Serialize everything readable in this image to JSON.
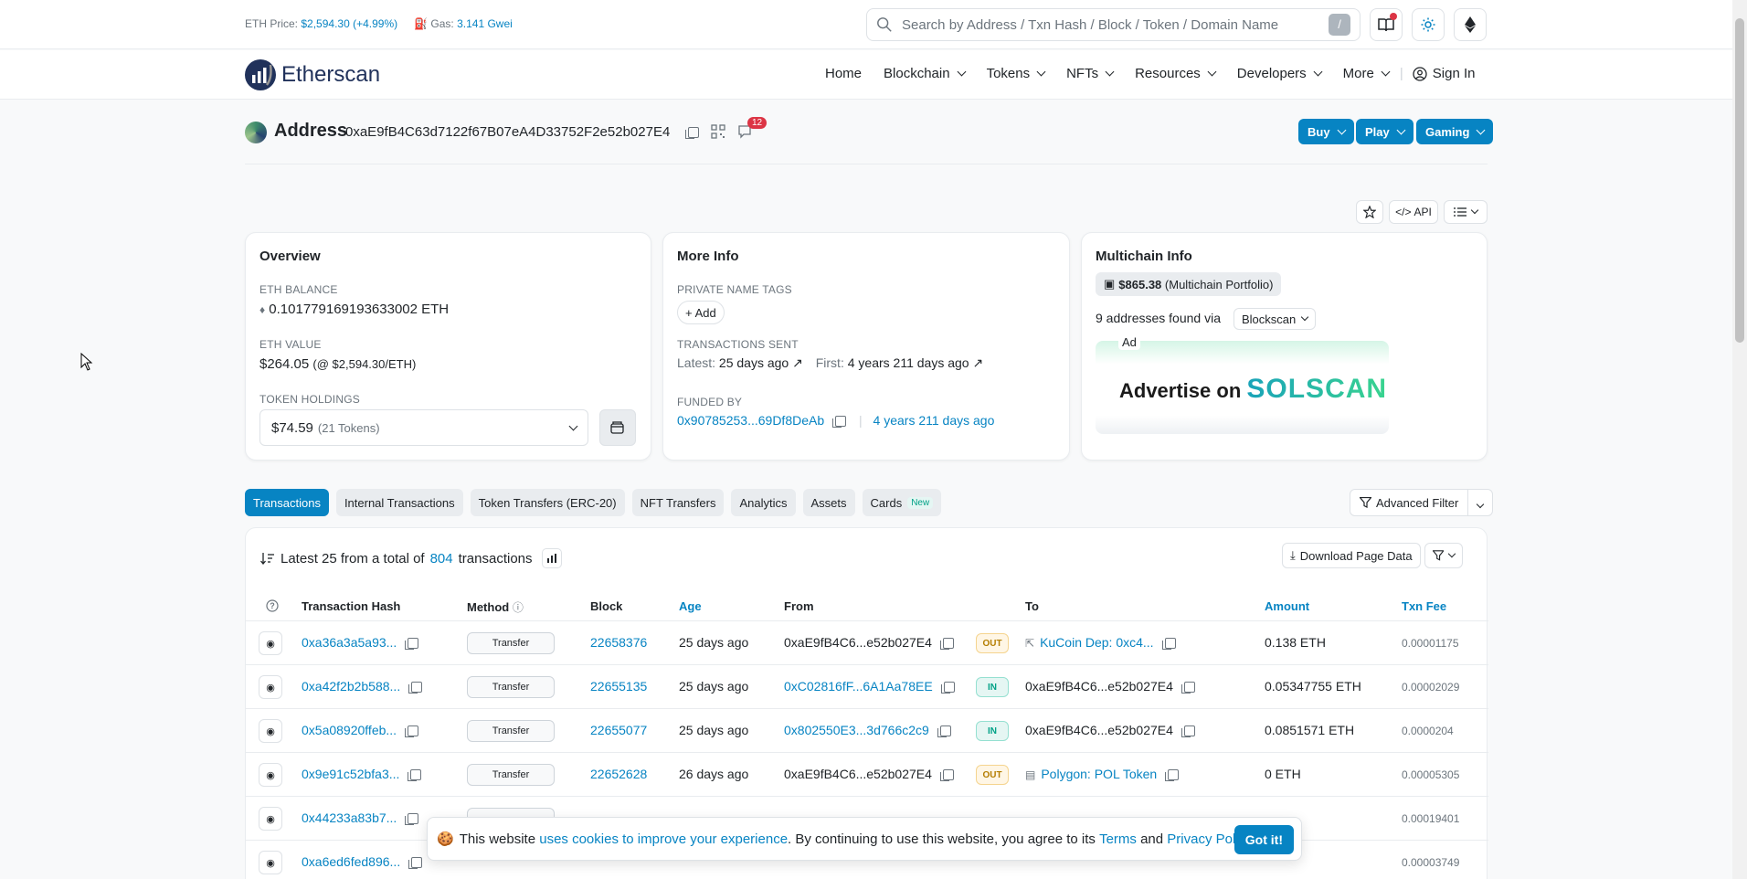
{
  "topbar": {
    "eth_price_label": "ETH Price:",
    "eth_price_value": "$2,594.30 (+4.99%)",
    "gas_label": "Gas:",
    "gas_value": "3.141 Gwei",
    "search_placeholder": "Search by Address / Txn Hash / Block / Token / Domain Name",
    "search_shortcut": "/"
  },
  "nav": {
    "logo_text": "Etherscan",
    "items": [
      "Home",
      "Blockchain",
      "Tokens",
      "NFTs",
      "Resources",
      "Developers",
      "More"
    ],
    "sign_in": "Sign In"
  },
  "address": {
    "title": "Address",
    "hash": "0xaE9fB4C63d7122f67B07eA4D33752F2e52b027E4",
    "comments_count": "12",
    "buttons": [
      "Buy",
      "Play",
      "Gaming"
    ],
    "api_label": "API"
  },
  "overview": {
    "title": "Overview",
    "eth_balance_label": "ETH BALANCE",
    "eth_balance": "0.101779169193633002 ETH",
    "eth_value_label": "ETH VALUE",
    "eth_value": "$264.05",
    "eth_value_rate": "(@ $2,594.30/ETH)",
    "token_holdings_label": "TOKEN HOLDINGS",
    "token_holdings_value": "$74.59",
    "token_holdings_count": "(21 Tokens)"
  },
  "more_info": {
    "title": "More Info",
    "private_tags_label": "PRIVATE NAME TAGS",
    "add_label": "Add",
    "tx_sent_label": "TRANSACTIONS SENT",
    "latest_label": "Latest:",
    "latest_value": "25 days ago",
    "first_label": "First:",
    "first_value": "4 years 211 days ago",
    "funded_by_label": "FUNDED BY",
    "funded_by_addr": "0x90785253...69Df8DeAb",
    "funded_by_age": "4 years 211 days ago"
  },
  "multichain": {
    "title": "Multichain Info",
    "portfolio_value": "$865.38",
    "portfolio_label": "(Multichain Portfolio)",
    "addresses_found": "9 addresses found via",
    "via": "Blockscan",
    "ad_tag": "Ad",
    "ad_text": "Advertise on",
    "ad_brand": "SOLSCAN"
  },
  "tabs": [
    "Transactions",
    "Internal Transactions",
    "Token Transfers (ERC-20)",
    "NFT Transfers",
    "Analytics",
    "Assets",
    "Cards"
  ],
  "tabs_new_badge": "New",
  "advanced_filter": "Advanced Filter",
  "txlist": {
    "summary_prefix": "Latest 25 from a total of",
    "summary_count": "804",
    "summary_suffix": "transactions",
    "download": "Download Page Data",
    "columns": [
      "Transaction Hash",
      "Method",
      "Block",
      "Age",
      "From",
      "To",
      "Amount",
      "Txn Fee"
    ],
    "rows": [
      {
        "hash": "0xa36a3a5a93...",
        "method": "Transfer",
        "block": "22658376",
        "age": "25 days ago",
        "from": "0xaE9fB4C6...e52b027E4",
        "dir": "OUT",
        "to": "KuCoin Dep: 0xc4...",
        "amount": "0.138 ETH",
        "fee": "0.00001175"
      },
      {
        "hash": "0xa42f2b2b588...",
        "method": "Transfer",
        "block": "22655135",
        "age": "25 days ago",
        "from": "0xC02816fF...6A1Aa78EE",
        "dir": "IN",
        "to": "0xaE9fB4C6...e52b027E4",
        "amount": "0.05347755 ETH",
        "fee": "0.00002029"
      },
      {
        "hash": "0x5a08920ffeb...",
        "method": "Transfer",
        "block": "22655077",
        "age": "25 days ago",
        "from": "0x802550E3...3d766c2c9",
        "dir": "IN",
        "to": "0xaE9fB4C6...e52b027E4",
        "amount": "0.0851571 ETH",
        "fee": "0.0000204"
      },
      {
        "hash": "0x9e91c52bfa3...",
        "method": "Transfer",
        "block": "22652628",
        "age": "26 days ago",
        "from": "0xaE9fB4C6...e52b027E4",
        "dir": "OUT",
        "to": "Polygon: POL Token",
        "amount": "0 ETH",
        "fee": "0.00005305"
      },
      {
        "hash": "0x44233a83b7...",
        "method": "",
        "block": "",
        "age": "",
        "from": "",
        "dir": "",
        "to": "",
        "amount": "",
        "fee": "0.00019401"
      },
      {
        "hash": "0xa6ed6fed896...",
        "method": "",
        "block": "",
        "age": "",
        "from": "",
        "dir": "",
        "to": "",
        "amount": "",
        "fee": "0.00003749"
      }
    ]
  },
  "cookie": {
    "text_1": "This website",
    "link_1": "uses cookies to improve your experience",
    "text_2": ". By continuing to use this website, you agree to its",
    "link_2": "Terms",
    "text_3": "and",
    "link_3": "Privacy Policy",
    "text_4": ".",
    "button": "Got it!"
  },
  "colors": {
    "accent": "#0784c3",
    "out_badge": "#b47d00",
    "in_badge": "#00a186"
  }
}
